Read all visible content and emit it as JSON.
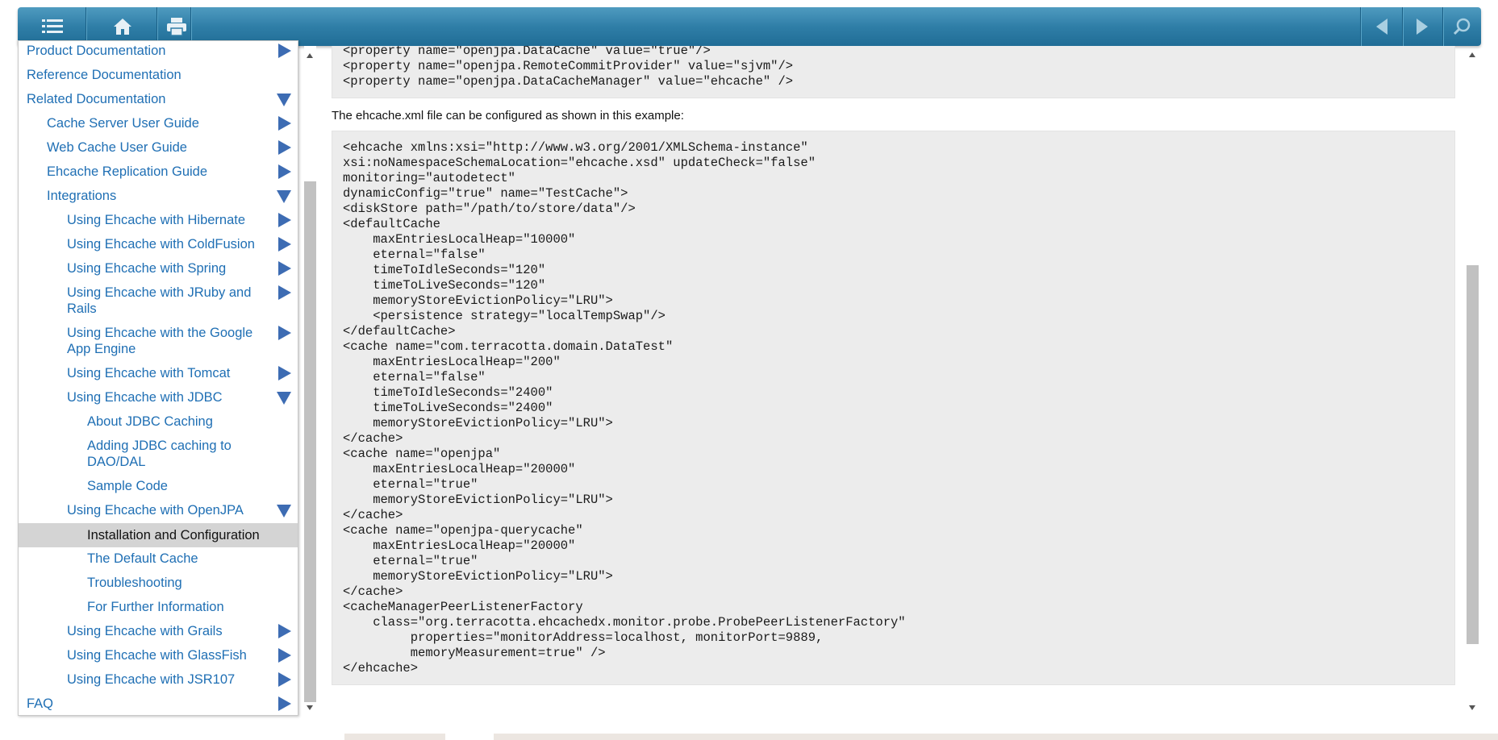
{
  "toolbar": {
    "buttons": [
      "menu-icon",
      "home-icon",
      "print-icon"
    ],
    "right_buttons": [
      "prev-icon",
      "next-icon",
      "search-icon"
    ],
    "colors": {
      "bar": "#2f7ea7",
      "icon": "#ffffff"
    }
  },
  "sidebar": {
    "items": [
      {
        "label": "Product Documentation",
        "arrow": "right"
      },
      {
        "label": "Reference Documentation",
        "arrow": ""
      },
      {
        "label": "Related Documentation",
        "arrow": "down"
      },
      {
        "label": "Cache Server User Guide",
        "arrow": "right"
      },
      {
        "label": "Web Cache User Guide",
        "arrow": "right"
      },
      {
        "label": "Ehcache Replication Guide",
        "arrow": "right"
      },
      {
        "label": "Integrations",
        "arrow": "down"
      },
      {
        "label": "Using Ehcache with Hibernate",
        "arrow": "right"
      },
      {
        "label": "Using Ehcache with ColdFusion",
        "arrow": "right"
      },
      {
        "label": "Using Ehcache with Spring",
        "arrow": "right"
      },
      {
        "label": "Using Ehcache with JRuby and",
        "label2": "Rails",
        "arrow": "right"
      },
      {
        "label": "Using Ehcache with the Google",
        "label2": "App Engine",
        "arrow": "right"
      },
      {
        "label": "Using Ehcache with Tomcat",
        "arrow": "right"
      },
      {
        "label": "Using Ehcache with JDBC",
        "arrow": "down"
      },
      {
        "label": "About JDBC Caching",
        "arrow": ""
      },
      {
        "label": "Adding JDBC caching to",
        "label2": "DAO/DAL",
        "arrow": ""
      },
      {
        "label": "Sample Code",
        "arrow": ""
      },
      {
        "label": "Using Ehcache with OpenJPA",
        "arrow": "down"
      },
      {
        "label": "Installation and Configuration",
        "arrow": "",
        "active": true
      },
      {
        "label": "The Default Cache",
        "arrow": ""
      },
      {
        "label": "Troubleshooting",
        "arrow": ""
      },
      {
        "label": "For Further Information",
        "arrow": ""
      },
      {
        "label": "Using Ehcache with Grails",
        "arrow": "right"
      },
      {
        "label": "Using Ehcache with GlassFish",
        "arrow": "right"
      },
      {
        "label": "Using Ehcache with JSR107",
        "arrow": "right"
      },
      {
        "label": "FAQ",
        "arrow": "right"
      }
    ]
  },
  "content": {
    "code_top": "<property name=\"openjpa.DataCache\" value=\"true\"/>\n<property name=\"openjpa.RemoteCommitProvider\" value=\"sjvm\"/>\n<property name=\"openjpa.DataCacheManager\" value=\"ehcache\" />",
    "paragraph": "The ehcache.xml file can be configured as shown in this example:",
    "code_main": "<ehcache xmlns:xsi=\"http://www.w3.org/2001/XMLSchema-instance\"\nxsi:noNamespaceSchemaLocation=\"ehcache.xsd\" updateCheck=\"false\"\nmonitoring=\"autodetect\"\ndynamicConfig=\"true\" name=\"TestCache\">\n<diskStore path=\"/path/to/store/data\"/>\n<defaultCache\n    maxEntriesLocalHeap=\"10000\"\n    eternal=\"false\"\n    timeToIdleSeconds=\"120\"\n    timeToLiveSeconds=\"120\"\n    memoryStoreEvictionPolicy=\"LRU\">\n    <persistence strategy=\"localTempSwap\"/>\n</defaultCache>\n<cache name=\"com.terracotta.domain.DataTest\"\n    maxEntriesLocalHeap=\"200\"\n    eternal=\"false\"\n    timeToIdleSeconds=\"2400\"\n    timeToLiveSeconds=\"2400\"\n    memoryStoreEvictionPolicy=\"LRU\">\n</cache>\n<cache name=\"openjpa\"\n    maxEntriesLocalHeap=\"20000\"\n    eternal=\"true\"\n    memoryStoreEvictionPolicy=\"LRU\">\n</cache>\n<cache name=\"openjpa-querycache\"\n    maxEntriesLocalHeap=\"20000\"\n    eternal=\"true\"\n    memoryStoreEvictionPolicy=\"LRU\">\n</cache>\n<cacheManagerPeerListenerFactory\n    class=\"org.terracotta.ehcachedx.monitor.probe.ProbePeerListenerFactory\"\n         properties=\"monitorAddress=localhost, monitorPort=9889,\n         memoryMeasurement=true\" />\n</ehcache>"
  }
}
